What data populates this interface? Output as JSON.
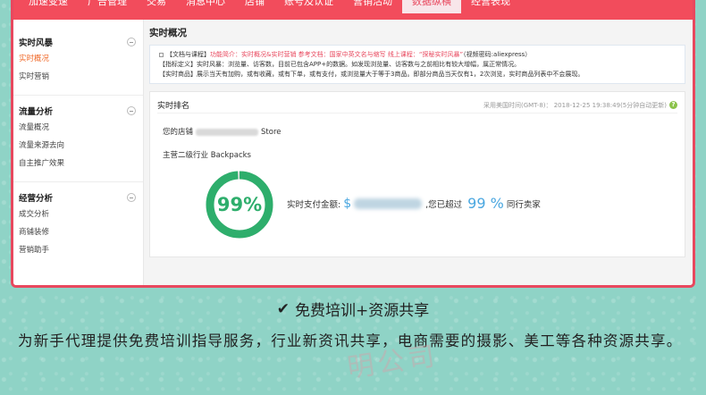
{
  "nav": {
    "items": [
      "加速变速",
      "广告管理",
      "交易",
      "消息中心",
      "店铺",
      "账号及认证",
      "营销活动",
      "数据纵横",
      "经营表现"
    ],
    "active_index": 7
  },
  "sidebar": {
    "groups": [
      {
        "title": "实时风暴",
        "items": [
          {
            "label": "实时概况",
            "active": true
          },
          {
            "label": "实时营销",
            "active": false
          }
        ]
      },
      {
        "title": "流量分析",
        "items": [
          {
            "label": "流量概况"
          },
          {
            "label": "流量来源去向"
          },
          {
            "label": "自主推广效果"
          }
        ]
      },
      {
        "title": "经营分析",
        "items": [
          {
            "label": "成交分析"
          },
          {
            "label": "商铺装修"
          },
          {
            "label": "营销助手"
          }
        ]
      }
    ]
  },
  "main": {
    "title": "实时概况",
    "notice": {
      "line1_a": "【文档与课程】",
      "line1_b": "功能简介：实时概况&实时营销   参考文档：国家中英文名与缩写  线上课程：“探秘实时风暴”",
      "line1_c": "（视频密码:aliexpress）",
      "line2": "【指标定义】实时风暴：浏览量、访客数，目前已包含APP+的数据。如发现浏览量、访客数与之前相比有较大增幅，属正常情况。",
      "line3": "【实时商品】展示当天有加购，或有收藏，或有下单，或有支付，或浏览量大于等于3商品。即部分商品当天仅有1，2次浏览，实时商品列表中不会展现。"
    },
    "panel": {
      "title": "实时排名",
      "time": "采用美国时间(GMT-8)： 2018-12-25 19:38:49(5分钟自动更新)",
      "help": "?",
      "store_prefix": "您的店铺",
      "store_suffix": "Store",
      "industry": "主营二级行业 Backpacks",
      "percent": 99,
      "percent_label": "99%",
      "pay_label": "实时支付金额:",
      "currency": "$",
      "exceed_label": ",您已超过",
      "exceed_value": "99 %",
      "peer_label": "同行卖家"
    }
  },
  "footer": {
    "title": "免费培训+资源共享",
    "text": "为新手代理提供免费培训指导服务，行业新资讯共享，电商需要的摄影、美工等各种资源共享。",
    "watermark": "明公司"
  },
  "colors": {
    "accent_red": "#f24c5c",
    "donut_green": "#2eae6c",
    "link_blue": "#4aa7e0",
    "background": "#8fd3c6"
  }
}
